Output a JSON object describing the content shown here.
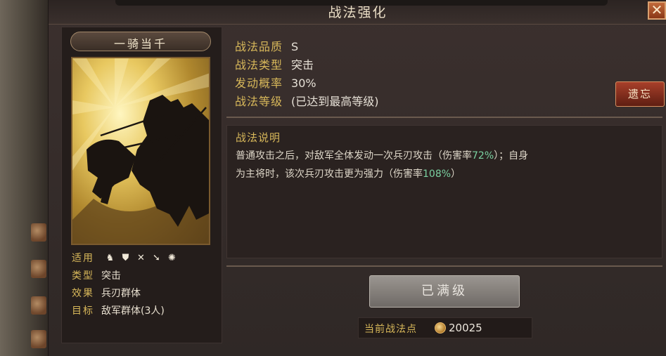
{
  "window": {
    "title": "战法强化",
    "close_icon": "close-icon"
  },
  "card": {
    "name": "一骑当千",
    "rows": [
      {
        "key": "适用",
        "icons": [
          "cavalry-icon",
          "shield-icon",
          "bow-icon",
          "spear-icon",
          "siege-icon"
        ]
      },
      {
        "key": "类型",
        "value": "突击"
      },
      {
        "key": "效果",
        "value": "兵刃群体"
      },
      {
        "key": "目标",
        "value": "敌军群体(3人)"
      }
    ]
  },
  "stats": [
    {
      "key": "战法品质",
      "value": "S"
    },
    {
      "key": "战法类型",
      "value": "突击"
    },
    {
      "key": "发动概率",
      "value": "30%"
    },
    {
      "key": "战法等级",
      "value": "(已达到最高等级)"
    }
  ],
  "forget_button": "遗忘",
  "description": {
    "title": "战法说明",
    "line1_a": "普通攻击之后，对敌军全体发动一次兵刃攻击（伤害率",
    "line1_pct": "72%",
    "line1_b": "）；自身",
    "line2_a": "为主将时，该次兵刃攻击更为强力（伤害率",
    "line2_pct": "108%",
    "line2_b": "）"
  },
  "max_level_button": "已满级",
  "points": {
    "label": "当前战法点",
    "value": "20025"
  },
  "colors": {
    "accent_gold": "#d8b85a",
    "highlight_green": "#7ad0a0",
    "forget_red": "#a8402a"
  }
}
